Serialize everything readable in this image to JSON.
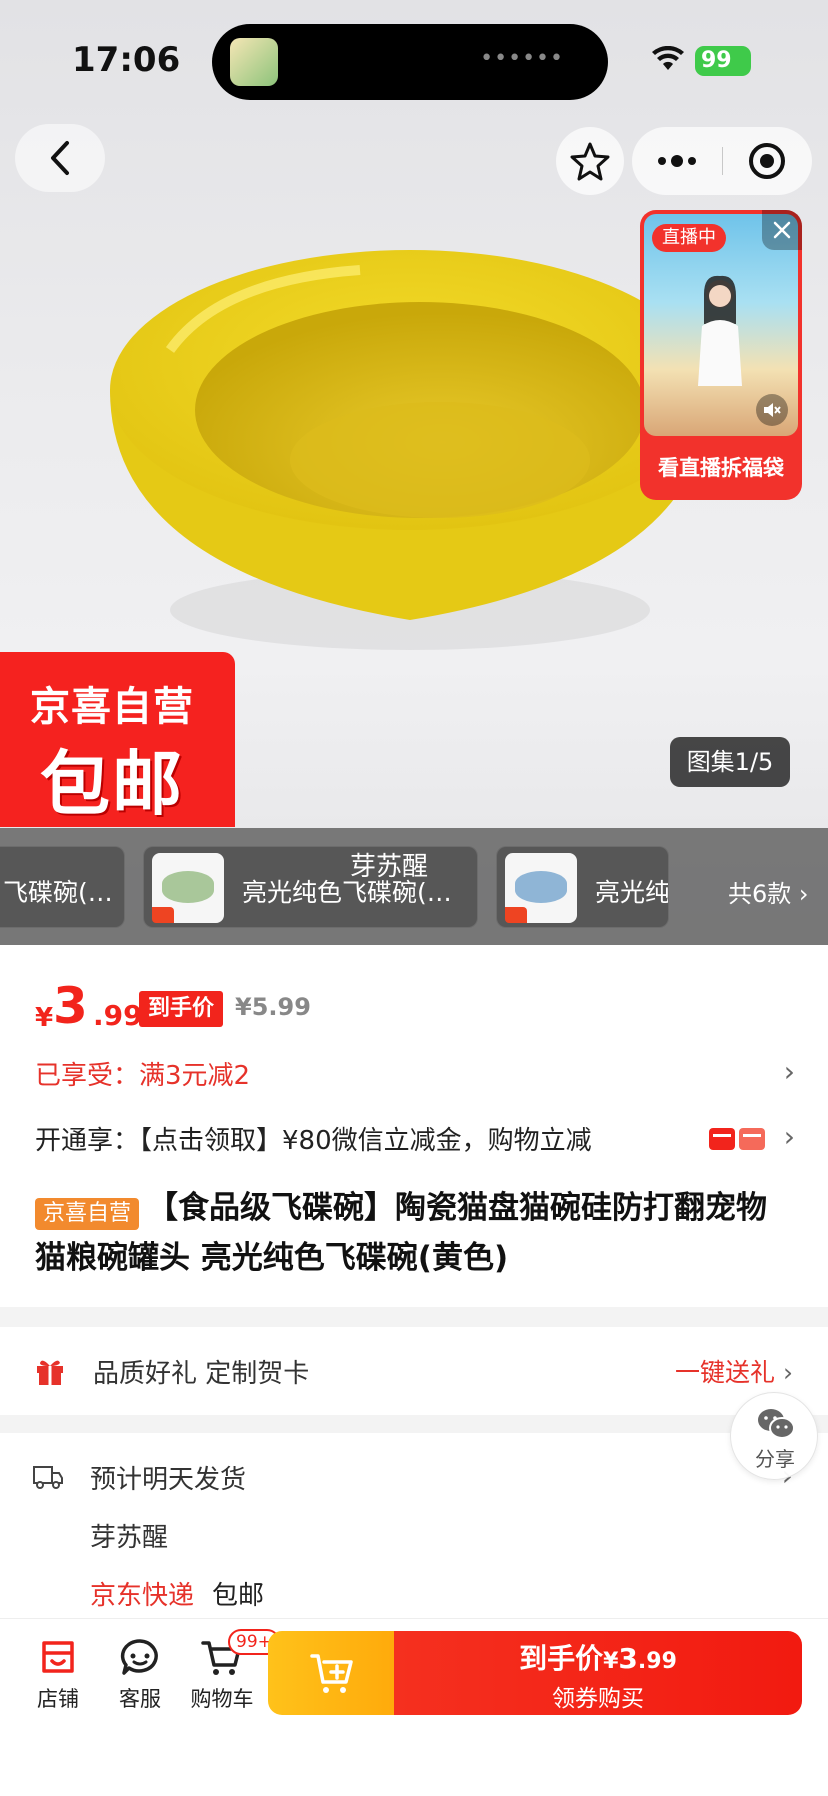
{
  "status_bar": {
    "time": "17:06",
    "battery": "99"
  },
  "hero": {
    "gallery_counter": "图集1/5",
    "promo_line1": "京喜自营",
    "promo_line2": "包邮",
    "live": {
      "badge": "直播中",
      "cta": "看直播拆福袋"
    }
  },
  "variants": {
    "items": [
      {
        "label": "飞碟碗(…",
        "color": "#e8d23a"
      },
      {
        "label": "亮光纯色飞碟碗(…",
        "color": "#a9c79a"
      },
      {
        "label": "亮光纯",
        "color": "#8fb5d6"
      }
    ],
    "overlay_text": "芽苏醒",
    "total": "共6款 ›"
  },
  "price": {
    "currency": "¥",
    "integer": "3",
    "decimal": ".99",
    "hand_price_tag": "到手价",
    "original": "¥5.99"
  },
  "enjoyed": {
    "text": "已享受：满3元减2"
  },
  "open_benefit": {
    "text": "开通享：【点击领取】¥80微信立减金，购物立减"
  },
  "product": {
    "badge": "京喜自营",
    "title": "【食品级飞碟碗】陶瓷猫盘猫碗硅防打翻宠物猫粮碗罐头 亮光纯色飞碟碗(黄色)"
  },
  "gift": {
    "text": "品质好礼 定制贺卡",
    "action": "一键送礼"
  },
  "delivery": {
    "ship_text": "预计明天发货",
    "store": "芽苏醒",
    "carrier": "京东快递",
    "shipping": "包邮"
  },
  "share": {
    "label": "分享"
  },
  "bottom_bar": {
    "store": "店铺",
    "service": "客服",
    "cart": "购物车",
    "cart_count": "99+",
    "buy_label": "到手价",
    "buy_price_cur": "¥",
    "buy_price_int": "3",
    "buy_price_dec": ".99",
    "buy_sub": "领券购买"
  },
  "colors": {
    "accent_red": "#f2241c",
    "orange_badge": "#f28a2e",
    "cart_yellow": "#ffb815"
  }
}
